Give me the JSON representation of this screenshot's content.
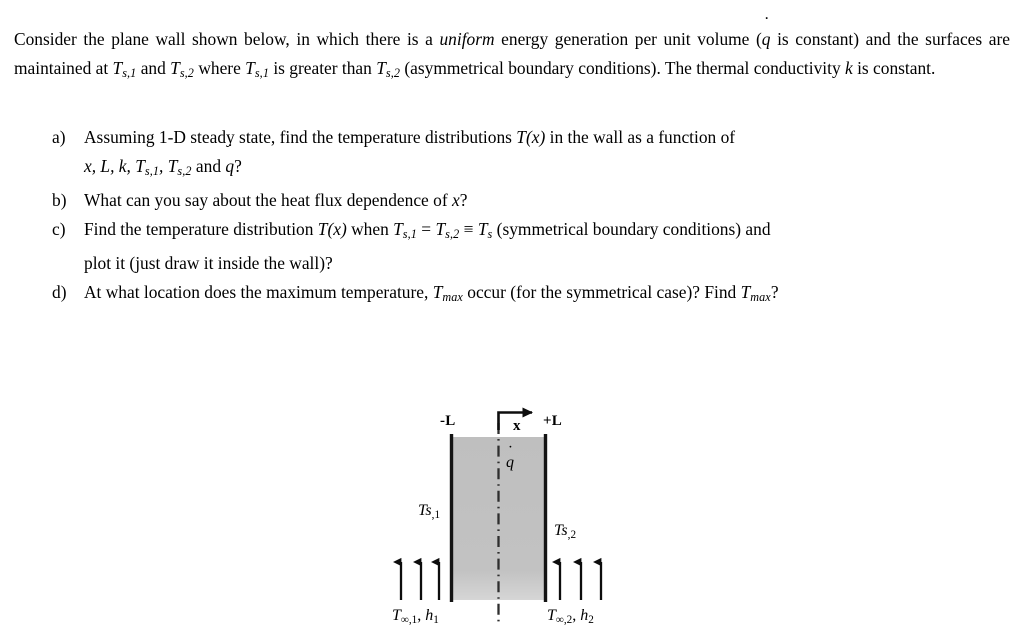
{
  "document": {
    "intro": {
      "seg1": "Consider the plane wall shown below, in which there is a ",
      "uniform": "uniform",
      "seg2": " energy generation per unit volume (",
      "qdot": "q",
      "seg3": " is constant) and the surfaces are maintained at ",
      "T": "T",
      "sub_s1": "s,1",
      "seg4": " and ",
      "sub_s2": "s,2",
      "seg5": " where ",
      "seg6": " is greater than ",
      "seg7": " (asymmetrical boundary conditions). The thermal conductivity ",
      "k": "k",
      "seg8": " is constant."
    },
    "questions": [
      {
        "marker": "a)",
        "line1_a": "Assuming 1-D steady state, find the temperature distributions ",
        "line1_T": "T",
        "line1_x": "(x)",
        "line1_b": " in the wall as a function of",
        "line2_vars": "x, L, k, T",
        "line2_sub1": "s,1",
        "line2_mid": ", T",
        "line2_sub2": "s,2",
        "line2_and": " and ",
        "line2_q": "q",
        "line2_end": "?"
      },
      {
        "marker": "b)",
        "text_a": "What can you say about the heat flux dependence of ",
        "text_x": "x",
        "text_b": "?"
      },
      {
        "marker": "c)",
        "line1_a": "Find the temperature distribution ",
        "line1_T": "T",
        "line1_x": "(x)",
        "line1_b": " when ",
        "line1_T1": "T",
        "line1_sub1": "s,1",
        "line1_eq": " = ",
        "line1_T2": "T",
        "line1_sub2": "s,2",
        "line1_equiv": " ≡ ",
        "line1_T3": "T",
        "line1_sub3": "s",
        "line1_c": " (symmetrical boundary conditions) and",
        "line2": "plot it (just draw it inside the wall)?"
      },
      {
        "marker": "d)",
        "text_a": "At what location does the maximum temperature, ",
        "text_T": "T",
        "text_sub": "max",
        "text_b": " occur (for the symmetrical case)? Find ",
        "text_T2": "T",
        "text_sub2": "max",
        "text_c": "?"
      }
    ]
  },
  "diagram": {
    "label_left_edge": "-L",
    "label_right_edge": "+L",
    "label_axis": "x",
    "label_generation": "q",
    "label_surface_1_T": "Ts",
    "label_surface_1_sub": ",1",
    "label_surface_2_T": "Ts",
    "label_surface_2_sub": ",2",
    "label_fluid_1_T": "T",
    "label_fluid_1_sub": "∞,1",
    "label_fluid_1_h": "h",
    "label_fluid_1_hsub": "1",
    "label_fluid_2_T": "T",
    "label_fluid_2_sub": "∞,2",
    "label_fluid_2_h": "h",
    "label_fluid_2_hsub": "2",
    "colors": {
      "wall_fill": "#c0c0c0",
      "wall_edge": "#1a1a1a",
      "centerline": "#2b2b2b",
      "arrow": "#0d0d0d"
    }
  }
}
